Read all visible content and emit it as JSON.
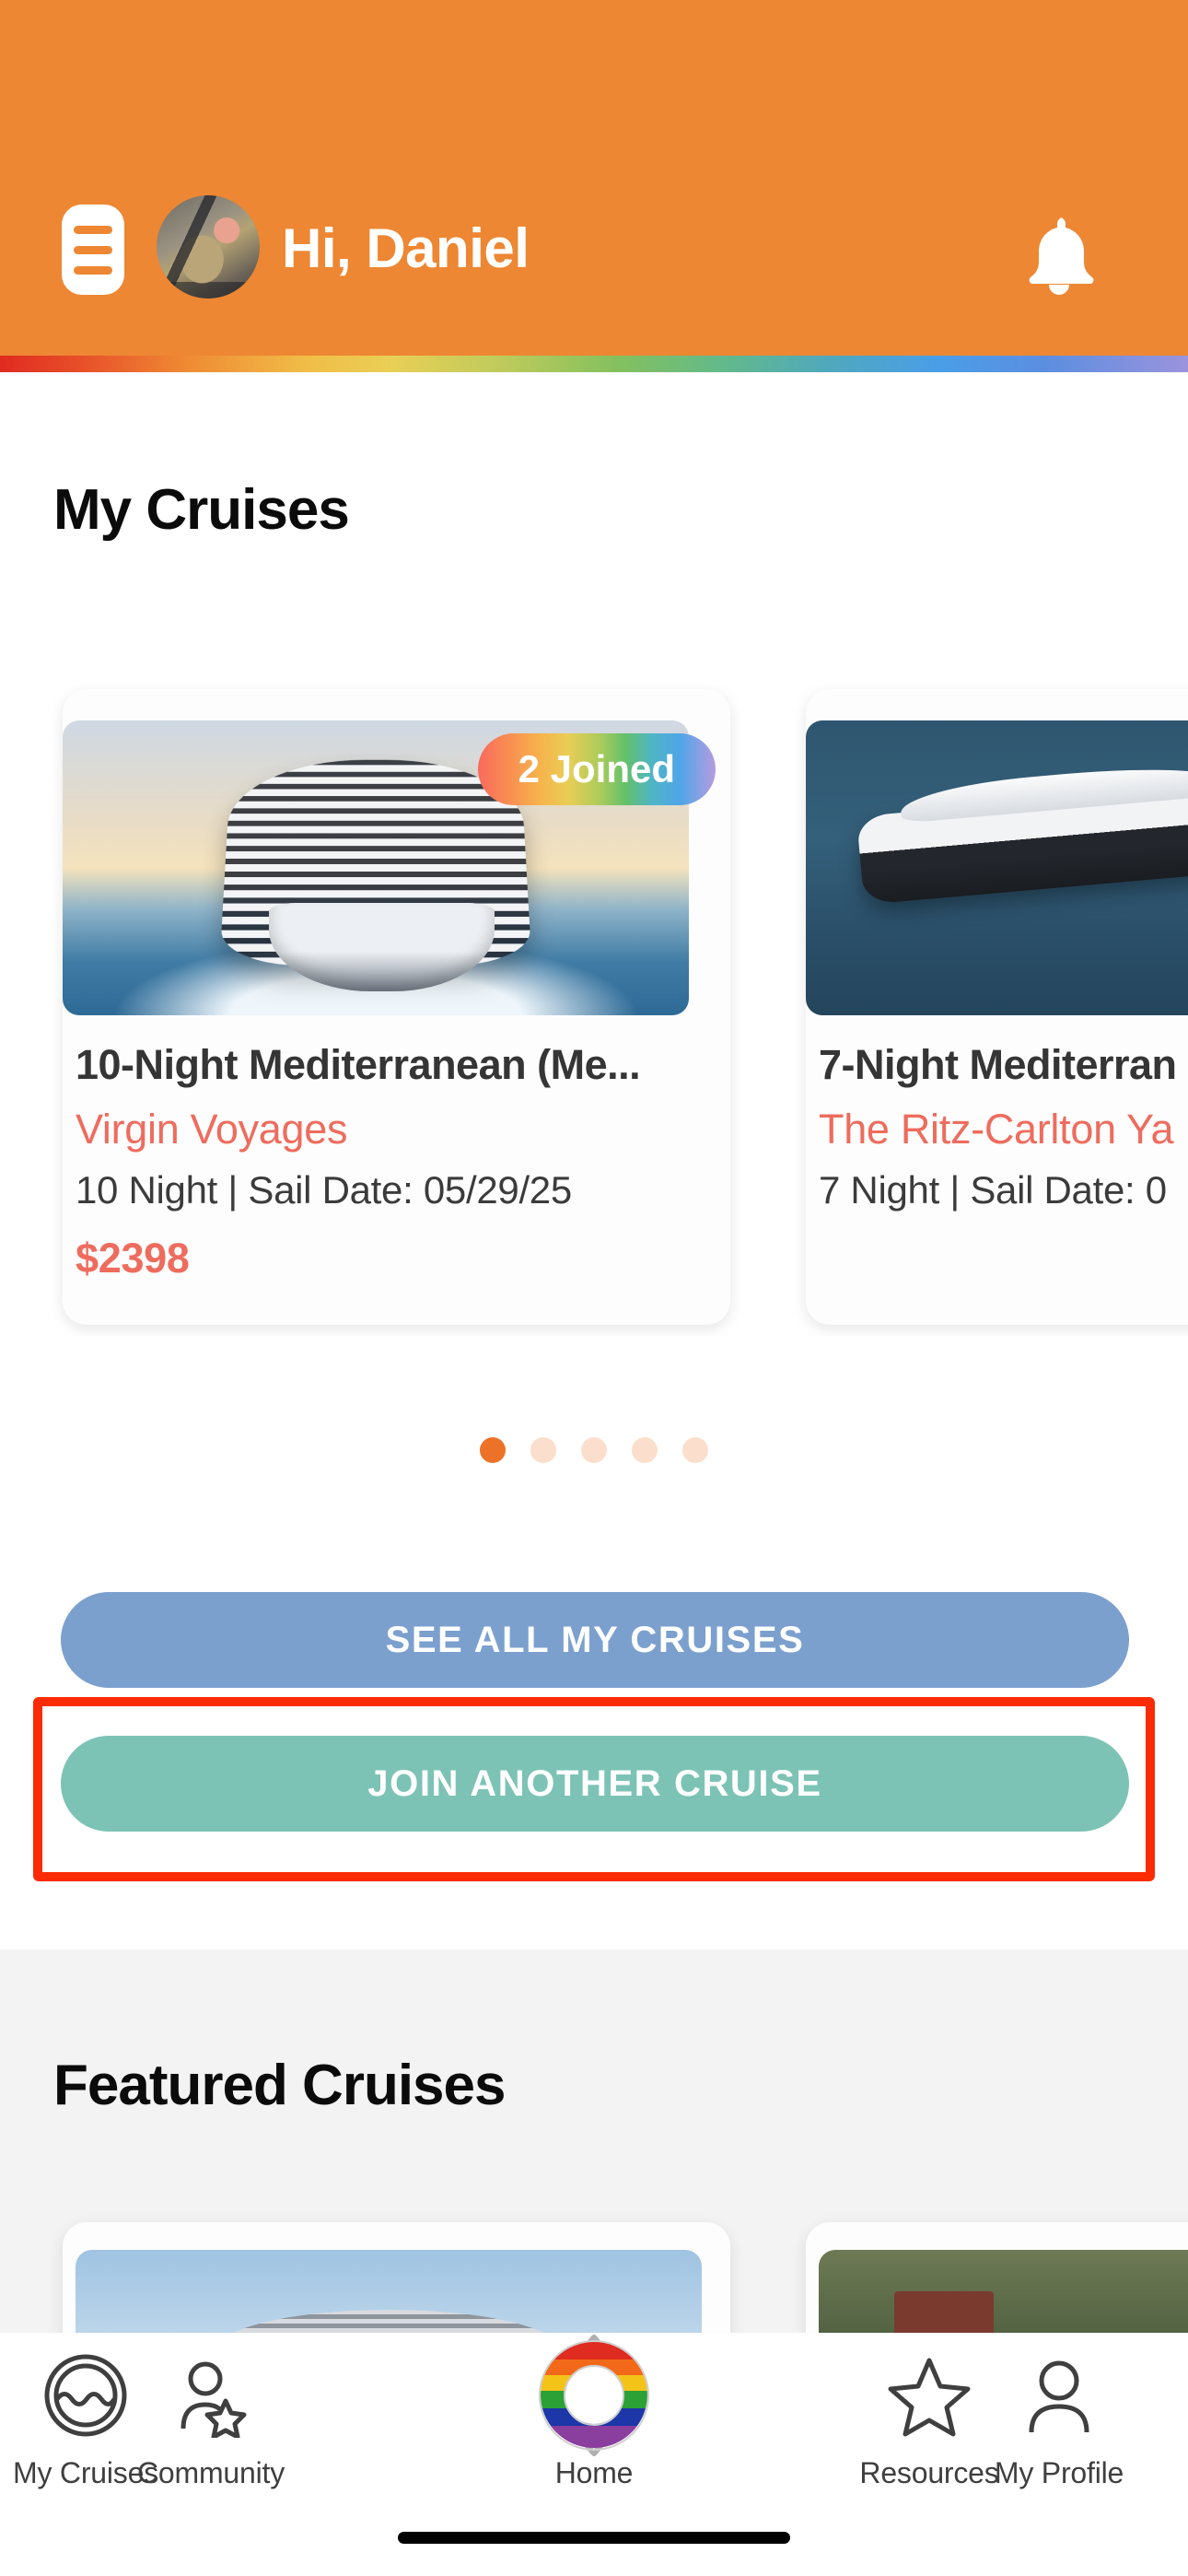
{
  "header": {
    "greeting": "Hi, Daniel",
    "menu_icon": "hamburger-menu-icon",
    "avatar_alt": "user-avatar",
    "bell_icon": "notification-bell-icon",
    "background_color": "#ED8733",
    "rainbow_colors": [
      "#E02B20",
      "#EF8C34",
      "#F0BE48",
      "#84C05E",
      "#4FA8BE",
      "#4A9EE8",
      "#9B93DD"
    ]
  },
  "my_cruises": {
    "section_title": "My Cruises",
    "cards": [
      {
        "badge": "2 Joined",
        "title": "10-Night Mediterranean (Me...",
        "cruise_line": "Virgin Voyages",
        "meta": "10 Night | Sail Date: 05/29/25",
        "price": "$2398",
        "photo": "virgin-voyages-ship-photo"
      },
      {
        "badge": "",
        "title": "7-Night Mediterran",
        "cruise_line": "The Ritz-Carlton Ya",
        "meta": "7 Night | Sail Date: 0",
        "price": "",
        "photo": "ritz-carlton-yacht-photo"
      }
    ],
    "dots": {
      "count": 5,
      "active_index": 0,
      "active_color": "#EC7227",
      "inactive_color": "#FBDECB"
    }
  },
  "actions": {
    "see_all_label": "SEE ALL MY CRUISES",
    "see_all_color": "#7CA0CE",
    "join_label": "JOIN ANOTHER CRUISE",
    "join_color": "#7CC3B5",
    "highlight_color": "#FB2B05"
  },
  "featured": {
    "section_title": "Featured Cruises",
    "cards": [
      {
        "photo": "cruise-ship-sky-photo"
      },
      {
        "photo": "port-aerial-photo"
      }
    ]
  },
  "bottom_nav": {
    "items": [
      {
        "label": "My Cruises",
        "icon": "wave-circle-icon",
        "active": false
      },
      {
        "label": "Community",
        "icon": "person-star-icon",
        "active": false
      },
      {
        "label": "Home",
        "icon": "rainbow-life-ring-icon",
        "active": true
      },
      {
        "label": "Resources",
        "icon": "star-icon",
        "active": false
      },
      {
        "label": "My Profile",
        "icon": "person-icon",
        "active": false
      }
    ]
  }
}
